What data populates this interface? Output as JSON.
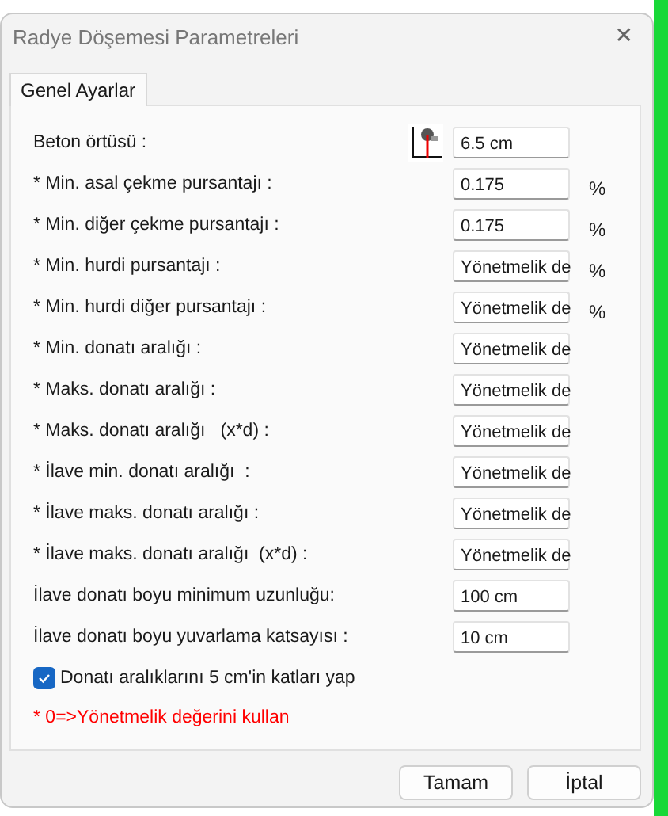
{
  "window": {
    "title": "Radye Döşemesi Parametreleri",
    "close": "✕"
  },
  "tabs": [
    {
      "label": "Genel Ayarlar",
      "selected": true
    }
  ],
  "rows": [
    {
      "label": "Beton örtüsü :",
      "value": "6.5 cm",
      "icon": true
    },
    {
      "label": "* Min. asal çekme pursantajı :",
      "value": "0.175",
      "unit": "%"
    },
    {
      "label": "* Min. diğer çekme pursantajı :",
      "value": "0.175",
      "unit": "%"
    },
    {
      "label": "* Min. hurdi pursantajı :",
      "value": "Yönetmelik de",
      "unit": "%"
    },
    {
      "label": "* Min. hurdi diğer pursantajı :",
      "value": "Yönetmelik de",
      "unit": "%"
    },
    {
      "label": "* Min. donatı aralığı :",
      "value": "Yönetmelik de"
    },
    {
      "label": "* Maks. donatı aralığı :",
      "value": "Yönetmelik de"
    },
    {
      "label": "* Maks. donatı aralığı   (x*d) :",
      "value": "Yönetmelik de"
    },
    {
      "label": "* İlave min. donatı aralığı  :",
      "value": "Yönetmelik de"
    },
    {
      "label": "* İlave maks. donatı aralığı :",
      "value": "Yönetmelik de"
    },
    {
      "label": "* İlave maks. donatı aralığı  (x*d) :",
      "value": "Yönetmelik de"
    },
    {
      "label": "İlave donatı boyu minimum uzunluğu:",
      "value": "100 cm"
    },
    {
      "label": "İlave donatı boyu yuvarlama katsayısı :",
      "value": "10 cm"
    }
  ],
  "checkbox": {
    "label": "Donatı aralıklarını 5 cm'in katları yap",
    "checked": true
  },
  "note": "* 0=>Yönetmelik değerini kullan",
  "buttons": [
    "Tamam",
    "İptal"
  ]
}
